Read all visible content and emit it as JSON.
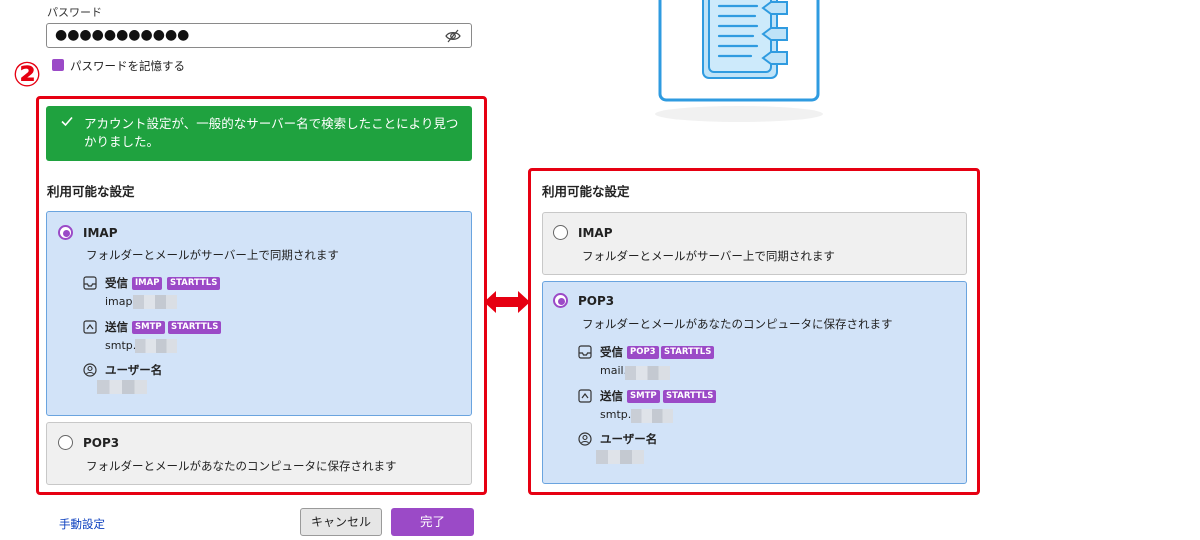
{
  "password": {
    "label": "パスワード",
    "value": "●●●●●●●●●●●",
    "remember_label": "パスワードを記憶する",
    "remember_checked": true
  },
  "callout_marker": "②",
  "banner": {
    "text": "アカウント設定が、一般的なサーバー名で検索したことにより見つかりました。"
  },
  "left_panel": {
    "section_title": "利用可能な設定",
    "imap": {
      "title": "IMAP",
      "desc": "フォルダーとメールがサーバー上で同期されます",
      "incoming_label": "受信",
      "incoming_badges": [
        "IMAP",
        "STARTTLS"
      ],
      "incoming_value": "imap.",
      "outgoing_label": "送信",
      "outgoing_badges": [
        "SMTP",
        "STARTTLS"
      ],
      "outgoing_value": "smtp.",
      "username_label": "ユーザー名"
    },
    "pop3": {
      "title": "POP3",
      "desc": "フォルダーとメールがあなたのコンピュータに保存されます"
    },
    "selected": "IMAP"
  },
  "right_panel": {
    "section_title": "利用可能な設定",
    "imap": {
      "title": "IMAP",
      "desc": "フォルダーとメールがサーバー上で同期されます"
    },
    "pop3": {
      "title": "POP3",
      "desc": "フォルダーとメールがあなたのコンピュータに保存されます",
      "incoming_label": "受信",
      "incoming_badges": [
        "POP3",
        "STARTTLS"
      ],
      "incoming_value": "mail.",
      "outgoing_label": "送信",
      "outgoing_badges": [
        "SMTP",
        "STARTTLS"
      ],
      "outgoing_value": "smtp.",
      "username_label": "ユーザー名"
    },
    "selected": "POP3"
  },
  "footer": {
    "manual_link": "手動設定",
    "cancel_label": "キャンセル",
    "done_label": "完了"
  },
  "colors": {
    "accent": "#9b4ac7",
    "success": "#1fa23f",
    "annotation_red": "#e60012",
    "selected_card": "#d2e3f8",
    "link": "#0b3fbf"
  }
}
